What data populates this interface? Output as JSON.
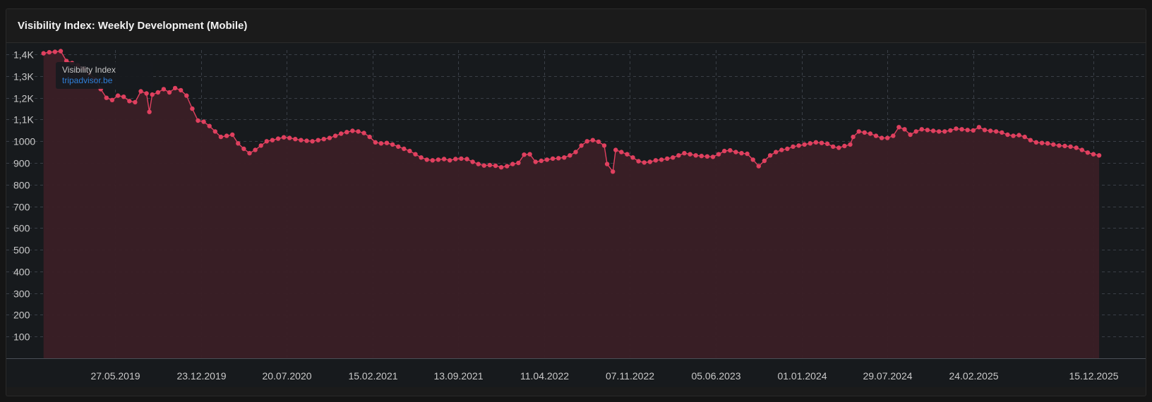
{
  "card": {
    "title": "Visibility Index: Weekly Development (Mobile)"
  },
  "tooltip": {
    "title": "Visibility Index",
    "domain": "tripadvisor.be"
  },
  "colors": {
    "line": "#e0405f",
    "area": "#3a1f26",
    "plot_bg": "#171a1d",
    "grid": "#3a3f47"
  },
  "chart_data": {
    "type": "area",
    "title": "Visibility Index: Weekly Development (Mobile)",
    "xlabel": "",
    "ylabel": "",
    "ylim": [
      0,
      1420
    ],
    "grid": true,
    "legend": "none",
    "y_ticks": [
      {
        "value": 100,
        "label": "100"
      },
      {
        "value": 200,
        "label": "200"
      },
      {
        "value": 300,
        "label": "300"
      },
      {
        "value": 400,
        "label": "400"
      },
      {
        "value": 500,
        "label": "500"
      },
      {
        "value": 600,
        "label": "600"
      },
      {
        "value": 700,
        "label": "700"
      },
      {
        "value": 800,
        "label": "800"
      },
      {
        "value": 900,
        "label": "900"
      },
      {
        "value": 1000,
        "label": "1000"
      },
      {
        "value": 1100,
        "label": "1,1K"
      },
      {
        "value": 1200,
        "label": "1,2K"
      },
      {
        "value": 1300,
        "label": "1,3K"
      },
      {
        "value": 1400,
        "label": "1,4K"
      }
    ],
    "x_ticks": [
      "27.05.2019",
      "23.12.2019",
      "20.07.2020",
      "15.02.2021",
      "13.09.2021",
      "11.04.2022",
      "07.11.2022",
      "05.06.2023",
      "01.01.2024",
      "29.07.2024",
      "24.02.2025",
      "15.12.2025"
    ],
    "series": [
      {
        "name": "tripadvisor.be",
        "points": [
          [
            "2018-12-03",
            1405
          ],
          [
            "2018-12-17",
            1410
          ],
          [
            "2018-12-31",
            1412
          ],
          [
            "2019-01-14",
            1415
          ],
          [
            "2019-01-28",
            1370
          ],
          [
            "2019-02-11",
            1360
          ],
          [
            "2019-02-25",
            1350
          ],
          [
            "2019-03-11",
            1335
          ],
          [
            "2019-03-25",
            1310
          ],
          [
            "2019-04-08",
            1285
          ],
          [
            "2019-04-22",
            1240
          ],
          [
            "2019-05-06",
            1200
          ],
          [
            "2019-05-20",
            1190
          ],
          [
            "2019-06-03",
            1210
          ],
          [
            "2019-06-17",
            1205
          ],
          [
            "2019-07-01",
            1185
          ],
          [
            "2019-07-15",
            1180
          ],
          [
            "2019-07-29",
            1230
          ],
          [
            "2019-08-12",
            1220
          ],
          [
            "2019-08-19",
            1135
          ],
          [
            "2019-08-26",
            1215
          ],
          [
            "2019-09-09",
            1225
          ],
          [
            "2019-09-23",
            1240
          ],
          [
            "2019-10-07",
            1225
          ],
          [
            "2019-10-21",
            1245
          ],
          [
            "2019-11-04",
            1235
          ],
          [
            "2019-11-18",
            1210
          ],
          [
            "2019-12-02",
            1150
          ],
          [
            "2019-12-16",
            1095
          ],
          [
            "2019-12-30",
            1090
          ],
          [
            "2020-01-13",
            1070
          ],
          [
            "2020-01-27",
            1045
          ],
          [
            "2020-02-10",
            1020
          ],
          [
            "2020-02-24",
            1025
          ],
          [
            "2020-03-09",
            1030
          ],
          [
            "2020-03-23",
            990
          ],
          [
            "2020-04-06",
            965
          ],
          [
            "2020-04-20",
            945
          ],
          [
            "2020-05-04",
            960
          ],
          [
            "2020-05-18",
            980
          ],
          [
            "2020-06-01",
            1000
          ],
          [
            "2020-06-15",
            1005
          ],
          [
            "2020-06-29",
            1012
          ],
          [
            "2020-07-13",
            1018
          ],
          [
            "2020-07-27",
            1015
          ],
          [
            "2020-08-10",
            1010
          ],
          [
            "2020-08-24",
            1005
          ],
          [
            "2020-09-07",
            1002
          ],
          [
            "2020-09-21",
            1000
          ],
          [
            "2020-10-05",
            1005
          ],
          [
            "2020-10-19",
            1010
          ],
          [
            "2020-11-02",
            1015
          ],
          [
            "2020-11-16",
            1025
          ],
          [
            "2020-11-30",
            1035
          ],
          [
            "2020-12-14",
            1042
          ],
          [
            "2020-12-28",
            1048
          ],
          [
            "2021-01-11",
            1045
          ],
          [
            "2021-01-25",
            1038
          ],
          [
            "2021-02-08",
            1020
          ],
          [
            "2021-02-22",
            995
          ],
          [
            "2021-03-08",
            990
          ],
          [
            "2021-03-22",
            992
          ],
          [
            "2021-04-05",
            985
          ],
          [
            "2021-04-19",
            975
          ],
          [
            "2021-05-03",
            965
          ],
          [
            "2021-05-17",
            955
          ],
          [
            "2021-05-31",
            940
          ],
          [
            "2021-06-14",
            925
          ],
          [
            "2021-06-28",
            915
          ],
          [
            "2021-07-12",
            912
          ],
          [
            "2021-07-26",
            915
          ],
          [
            "2021-08-09",
            918
          ],
          [
            "2021-08-23",
            912
          ],
          [
            "2021-09-06",
            918
          ],
          [
            "2021-09-20",
            920
          ],
          [
            "2021-10-04",
            918
          ],
          [
            "2021-10-18",
            905
          ],
          [
            "2021-11-01",
            895
          ],
          [
            "2021-11-15",
            888
          ],
          [
            "2021-11-29",
            890
          ],
          [
            "2021-12-13",
            887
          ],
          [
            "2021-12-27",
            880
          ],
          [
            "2022-01-10",
            885
          ],
          [
            "2022-01-24",
            895
          ],
          [
            "2022-02-07",
            900
          ],
          [
            "2022-02-21",
            938
          ],
          [
            "2022-03-07",
            940
          ],
          [
            "2022-03-21",
            905
          ],
          [
            "2022-04-04",
            910
          ],
          [
            "2022-04-18",
            915
          ],
          [
            "2022-05-02",
            920
          ],
          [
            "2022-05-16",
            922
          ],
          [
            "2022-05-30",
            925
          ],
          [
            "2022-06-13",
            935
          ],
          [
            "2022-06-27",
            950
          ],
          [
            "2022-07-11",
            980
          ],
          [
            "2022-07-25",
            1000
          ],
          [
            "2022-08-08",
            1005
          ],
          [
            "2022-08-22",
            998
          ],
          [
            "2022-09-05",
            980
          ],
          [
            "2022-09-12",
            895
          ],
          [
            "2022-09-26",
            860
          ],
          [
            "2022-10-03",
            960
          ],
          [
            "2022-10-17",
            950
          ],
          [
            "2022-10-31",
            940
          ],
          [
            "2022-11-14",
            925
          ],
          [
            "2022-11-28",
            908
          ],
          [
            "2022-12-12",
            902
          ],
          [
            "2022-12-26",
            905
          ],
          [
            "2023-01-09",
            912
          ],
          [
            "2023-01-23",
            915
          ],
          [
            "2023-02-06",
            920
          ],
          [
            "2023-02-20",
            925
          ],
          [
            "2023-03-06",
            935
          ],
          [
            "2023-03-20",
            945
          ],
          [
            "2023-04-03",
            940
          ],
          [
            "2023-04-17",
            935
          ],
          [
            "2023-05-01",
            932
          ],
          [
            "2023-05-15",
            930
          ],
          [
            "2023-05-29",
            928
          ],
          [
            "2023-06-12",
            940
          ],
          [
            "2023-06-26",
            955
          ],
          [
            "2023-07-10",
            958
          ],
          [
            "2023-07-24",
            950
          ],
          [
            "2023-08-07",
            945
          ],
          [
            "2023-08-21",
            942
          ],
          [
            "2023-09-04",
            915
          ],
          [
            "2023-09-18",
            885
          ],
          [
            "2023-10-02",
            910
          ],
          [
            "2023-10-16",
            935
          ],
          [
            "2023-10-30",
            950
          ],
          [
            "2023-11-13",
            960
          ],
          [
            "2023-11-27",
            965
          ],
          [
            "2023-12-11",
            975
          ],
          [
            "2023-12-25",
            980
          ],
          [
            "2024-01-08",
            985
          ],
          [
            "2024-01-22",
            990
          ],
          [
            "2024-02-05",
            995
          ],
          [
            "2024-02-19",
            992
          ],
          [
            "2024-03-04",
            988
          ],
          [
            "2024-03-18",
            975
          ],
          [
            "2024-04-01",
            970
          ],
          [
            "2024-04-15",
            978
          ],
          [
            "2024-04-29",
            985
          ],
          [
            "2024-05-06",
            1020
          ],
          [
            "2024-05-20",
            1045
          ],
          [
            "2024-06-03",
            1040
          ],
          [
            "2024-06-17",
            1035
          ],
          [
            "2024-07-01",
            1025
          ],
          [
            "2024-07-15",
            1015
          ],
          [
            "2024-07-29",
            1015
          ],
          [
            "2024-08-12",
            1025
          ],
          [
            "2024-08-26",
            1065
          ],
          [
            "2024-09-09",
            1055
          ],
          [
            "2024-09-23",
            1030
          ],
          [
            "2024-10-07",
            1045
          ],
          [
            "2024-10-21",
            1055
          ],
          [
            "2024-11-04",
            1052
          ],
          [
            "2024-11-18",
            1048
          ],
          [
            "2024-12-02",
            1045
          ],
          [
            "2024-12-16",
            1045
          ],
          [
            "2024-12-30",
            1050
          ],
          [
            "2025-01-13",
            1058
          ],
          [
            "2025-01-27",
            1055
          ],
          [
            "2025-02-10",
            1052
          ],
          [
            "2025-02-24",
            1050
          ],
          [
            "2025-03-10",
            1065
          ],
          [
            "2025-03-24",
            1052
          ],
          [
            "2025-04-07",
            1048
          ],
          [
            "2025-04-21",
            1045
          ],
          [
            "2025-05-05",
            1040
          ],
          [
            "2025-05-19",
            1030
          ],
          [
            "2025-06-02",
            1025
          ],
          [
            "2025-06-16",
            1028
          ],
          [
            "2025-06-30",
            1020
          ],
          [
            "2025-07-14",
            1005
          ],
          [
            "2025-07-28",
            995
          ],
          [
            "2025-08-11",
            992
          ],
          [
            "2025-08-25",
            990
          ],
          [
            "2025-09-08",
            985
          ],
          [
            "2025-09-22",
            980
          ],
          [
            "2025-10-06",
            978
          ],
          [
            "2025-10-20",
            975
          ],
          [
            "2025-11-03",
            970
          ],
          [
            "2025-11-17",
            960
          ],
          [
            "2025-12-01",
            948
          ],
          [
            "2025-12-15",
            940
          ],
          [
            "2025-12-29",
            935
          ]
        ]
      }
    ]
  }
}
